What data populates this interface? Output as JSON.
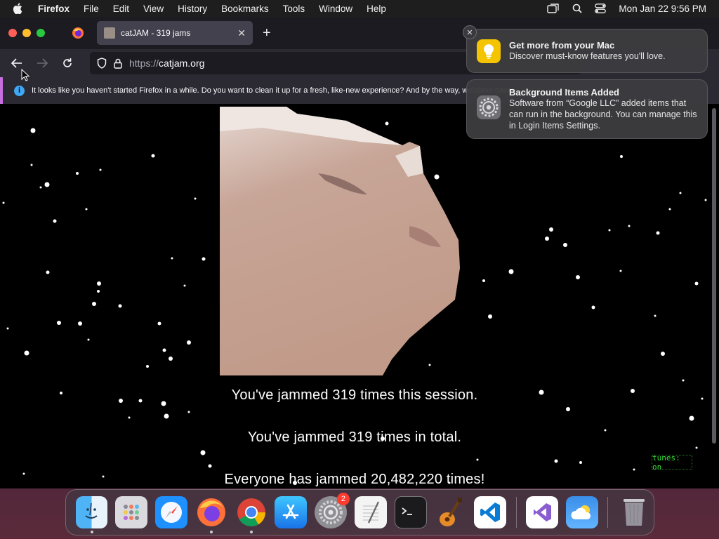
{
  "menubar": {
    "app_name": "Firefox",
    "items": [
      "File",
      "Edit",
      "View",
      "History",
      "Bookmarks",
      "Tools",
      "Window",
      "Help"
    ],
    "clock": "Mon Jan 22  9:56 PM"
  },
  "browser": {
    "tab_title": "catJAM - 319 jams",
    "url_protocol": "https://",
    "url_host": "catjam.org",
    "infobar_text": "It looks like you haven't started Firefox in a while. Do you want to clean it up for a fresh, like-new experience? And by the way, welcome back!"
  },
  "page": {
    "session_line": "You've jammed 319 times this session.",
    "total_line": "You've jammed 319 times in total.",
    "everyone_line": "Everyone has jammed 20,482,220 times!",
    "tunes_toggle": "tunes: on"
  },
  "notifications": [
    {
      "title": "Get more from your Mac",
      "body": "Discover must-know features you'll love.",
      "icon": "lightbulb-icon"
    },
    {
      "title": "Background Items Added",
      "body": "Software from “Google LLC” added items that can run in the background. You can manage this in Login Items Settings.",
      "icon": "gear-icon"
    }
  ],
  "dock": {
    "apps": [
      "Finder",
      "Launchpad",
      "Safari",
      "Firefox",
      "Chrome",
      "App Store",
      "System Settings",
      "TextEdit",
      "Terminal",
      "GarageBand",
      "Visual Studio Code",
      "Visual Studio",
      "Weather",
      "Trash"
    ],
    "settings_badge": "2"
  },
  "colors": {
    "accent_blue": "#3fa9f5",
    "tunes_green": "#36e236",
    "infobar_border": "#c86fe0"
  }
}
